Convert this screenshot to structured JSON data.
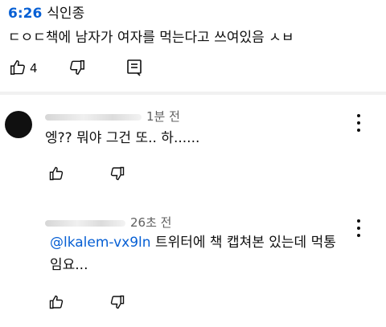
{
  "post": {
    "timestamp": "6:26",
    "topic": "식인종",
    "text": "ㄷㅇㄷ책에 남자가 여자를 먹는다고 쓰여있음 ㅅㅂ",
    "like_count": "4"
  },
  "comments": [
    {
      "age": "1분 전",
      "text": "엥?? 뭐야 그건 또.. 하......"
    },
    {
      "age": "26초 전",
      "mention": "@lkalem-vx9ln",
      "text_line1": " 트위터에 책 캡쳐본 있는데 먹통",
      "text_line2": "임요..."
    }
  ],
  "icons": {
    "like": "thumb-up-icon",
    "dislike": "thumb-down-icon",
    "reply": "comment-icon",
    "more": "more-vertical-icon"
  }
}
